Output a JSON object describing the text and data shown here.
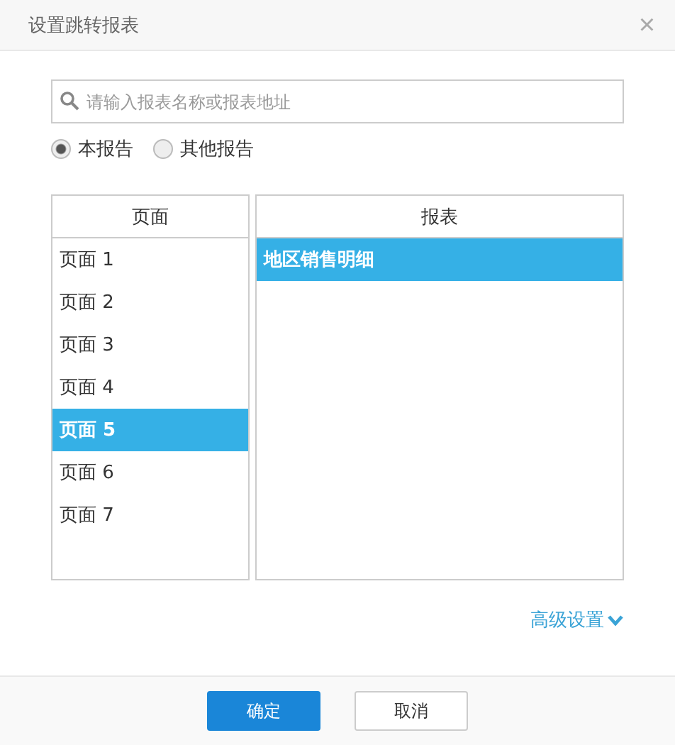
{
  "window": {
    "title": "设置跳转报表",
    "close": "×"
  },
  "search": {
    "placeholder": "请输入报表名称或报表地址"
  },
  "scope": [
    {
      "label": "本报告",
      "selected": true
    },
    {
      "label": "其他报告",
      "selected": false
    }
  ],
  "pages": {
    "heading": "页面",
    "items": [
      {
        "label": "页面 1",
        "selected": false
      },
      {
        "label": "页面 2",
        "selected": false
      },
      {
        "label": "页面 3",
        "selected": false
      },
      {
        "label": "页面 4",
        "selected": false
      },
      {
        "label": "页面 5",
        "selected": true
      },
      {
        "label": "页面 6",
        "selected": false
      },
      {
        "label": "页面 7",
        "selected": false
      }
    ]
  },
  "reports": {
    "heading": "报表",
    "items": [
      {
        "label": "地区销售明细",
        "selected": true
      }
    ]
  },
  "advanced": {
    "label": "高级设置",
    "expanded": false
  },
  "buttons": [
    {
      "label": "确定",
      "kind": "primary"
    },
    {
      "label": "取消",
      "kind": "secondary"
    }
  ]
}
